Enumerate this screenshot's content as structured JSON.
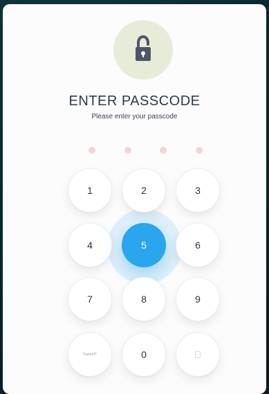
{
  "page": {
    "title": "ENTER PASSCODE",
    "subtitle": "Please enter your passcode"
  },
  "icons": {
    "lock": "unlock-icon",
    "blank_key": "blank-key-icon"
  },
  "colors": {
    "accent": "#2aa6ee",
    "lock_bg": "#e7ecd8",
    "dot": "#f2d6d6",
    "text": "#2f3a4a"
  },
  "passcode": {
    "dot_count": 4,
    "filled": 0
  },
  "keypad": {
    "active_key": "5",
    "keys": [
      {
        "label": "1"
      },
      {
        "label": "2"
      },
      {
        "label": "3"
      },
      {
        "label": "4"
      },
      {
        "label": "5"
      },
      {
        "label": "6"
      },
      {
        "label": "7"
      },
      {
        "label": "8"
      },
      {
        "label": "9"
      },
      {
        "label": "Cancel?"
      },
      {
        "label": "0"
      },
      {
        "label": ""
      }
    ]
  }
}
